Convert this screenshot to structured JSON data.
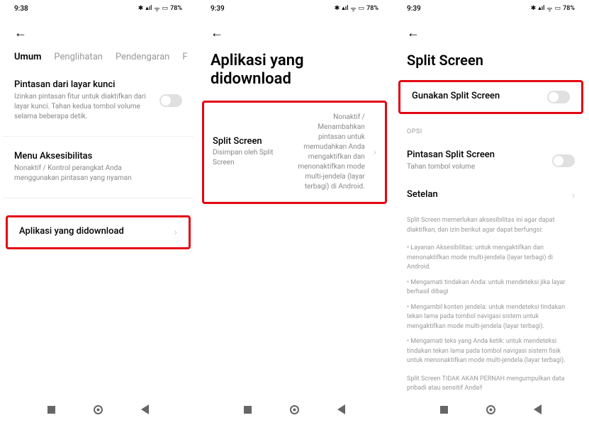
{
  "screen1": {
    "time": "9:38",
    "battery": "78%",
    "tabs": {
      "umum": "Umum",
      "penglihatan": "Penglihatan",
      "pendengaran": "Pendengaran",
      "f": "F"
    },
    "shortcut": {
      "title": "Pintasan dari layar kunci",
      "desc": "Izinkan pintasan fitur untuk diaktifkan dari layar kunci. Tahan kedua tombol volume selama beberapa detik."
    },
    "accessibility": {
      "title": "Menu Aksesibilitas",
      "desc": "Nonaktif / Kontrol perangkat Anda menggunakan pintasan yang nyaman"
    },
    "downloaded": {
      "title": "Aplikasi yang didownload"
    }
  },
  "screen2": {
    "time": "9:39",
    "battery": "78%",
    "title": "Aplikasi yang didownload",
    "splitscreen": {
      "title": "Split Screen",
      "subtitle": "Disimpan oleh Split Screen",
      "desc": "Nonaktif / Menambahkan pintasan untuk memudahkan Anda mengaktifkan dan menonaktifkan mode multi-jendela (layar terbagi) di Android."
    }
  },
  "screen3": {
    "time": "9:39",
    "battery": "78%",
    "title": "Split Screen",
    "use": {
      "title": "Gunakan Split Screen"
    },
    "opsi_label": "OPSI",
    "shortcut": {
      "title": "Pintasan Split Screen",
      "desc": "Tahan tombol volume"
    },
    "settings": {
      "title": "Setelan"
    },
    "info1": "Split Screen memerlukan aksesibilitas ini agar dapat diaktifkan, dan izin berikut agar dapat berfungsi:",
    "bullet1": "• Layanan Aksesibilitas: untuk mengaktifkan dan menonaktifkan mode multi-jendela (layar terbagi) di Android.",
    "bullet2": "• Mengamati tindakan Anda: untuk mendeteksi jika layar berhasil dibagi",
    "bullet3": "• Mengambil konten jendela: untuk mendeteksi tindakan tekan lama pada tombol navigasi sistem untuk mengaktifkan mode multi-jendela (layar terbagi).",
    "bullet4": "• Mengamati teks yang Anda ketik: untuk mendeteksi tindakan tekan lama pada tombol navigasi sistem fisik untuk menonaktifkan mode multi-jendela (layar terbagi).",
    "info2": "Split Screen TIDAK AKAN PERNAH mengumpulkan data pribadi atau sensitif Anda!!"
  },
  "status_icons": "✱ ⫴ ᯤ ⏻"
}
